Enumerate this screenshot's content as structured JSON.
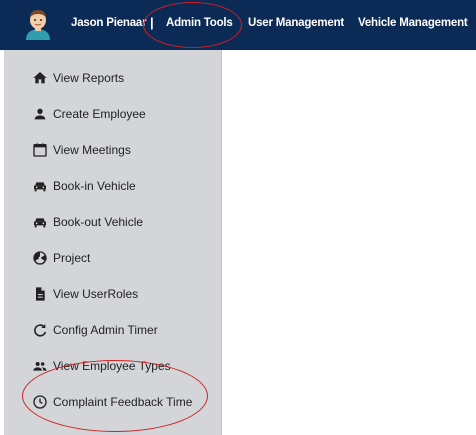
{
  "header": {
    "user_name": "Jason Pienaar",
    "separator": "|",
    "nav": [
      {
        "label": "Admin Tools"
      },
      {
        "label": "User Management"
      },
      {
        "label": "Vehicle Management"
      }
    ]
  },
  "sidebar": {
    "items": [
      {
        "label": "View Reports",
        "icon": "home-icon"
      },
      {
        "label": "Create Employee",
        "icon": "person-icon"
      },
      {
        "label": "View Meetings",
        "icon": "calendar-icon"
      },
      {
        "label": "Book-in Vehicle",
        "icon": "car-icon"
      },
      {
        "label": "Book-out Vehicle",
        "icon": "car-icon"
      },
      {
        "label": "Project",
        "icon": "radiation-icon"
      },
      {
        "label": "View UserRoles",
        "icon": "document-icon"
      },
      {
        "label": "Config Admin Timer",
        "icon": "refresh-icon"
      },
      {
        "label": "View Employee Types",
        "icon": "people-icon"
      },
      {
        "label": "Complaint Feedback Time",
        "icon": "clock-icon"
      }
    ]
  },
  "colors": {
    "topbar": "#0b2a55",
    "sidebar": "#d3d5d9",
    "annotation": "#d21f1f"
  }
}
